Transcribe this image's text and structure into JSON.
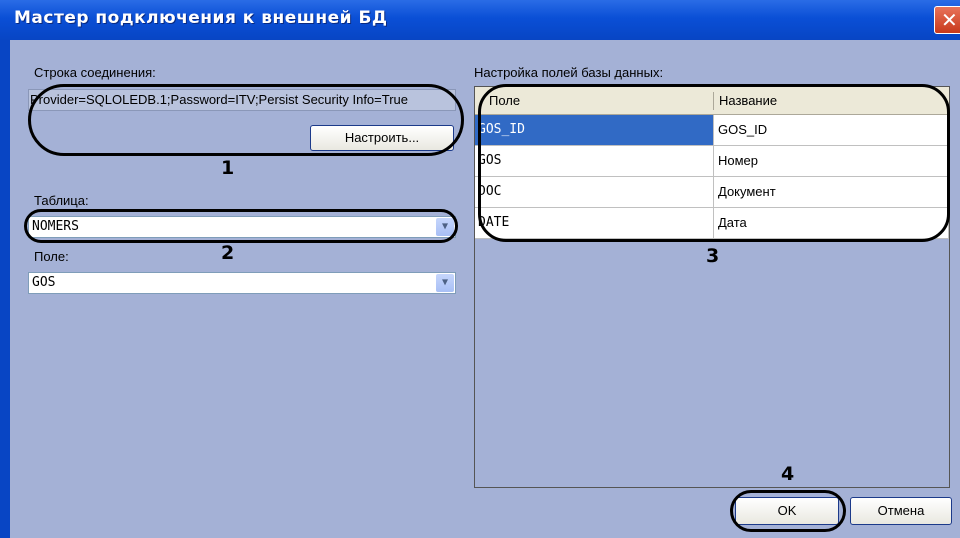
{
  "window": {
    "title": "Мастер подключения к внешней БД"
  },
  "connection": {
    "label": "Строка соединения:",
    "value": "Provider=SQLOLEDB.1;Password=ITV;Persist Security Info=True",
    "configure_button": "Настроить..."
  },
  "table": {
    "label": "Таблица:",
    "value": "NOMERS"
  },
  "field": {
    "label": "Поле:",
    "value": "GOS"
  },
  "fields_grid": {
    "label": "Настройка полей базы данных:",
    "columns": [
      "Поле",
      "Название"
    ],
    "rows": [
      {
        "field": "GOS_ID",
        "name": "GOS_ID"
      },
      {
        "field": "GOS",
        "name": "Номер"
      },
      {
        "field": "DOC",
        "name": "Документ"
      },
      {
        "field": "DATE",
        "name": "Дата"
      }
    ]
  },
  "buttons": {
    "ok": "OK",
    "cancel": "Отмена"
  },
  "annotations": [
    "1",
    "2",
    "3",
    "4"
  ],
  "colors": {
    "selection": "#316ac5",
    "titlebar": "#0a4fd6",
    "dialog_bg": "#a4b1d6"
  }
}
